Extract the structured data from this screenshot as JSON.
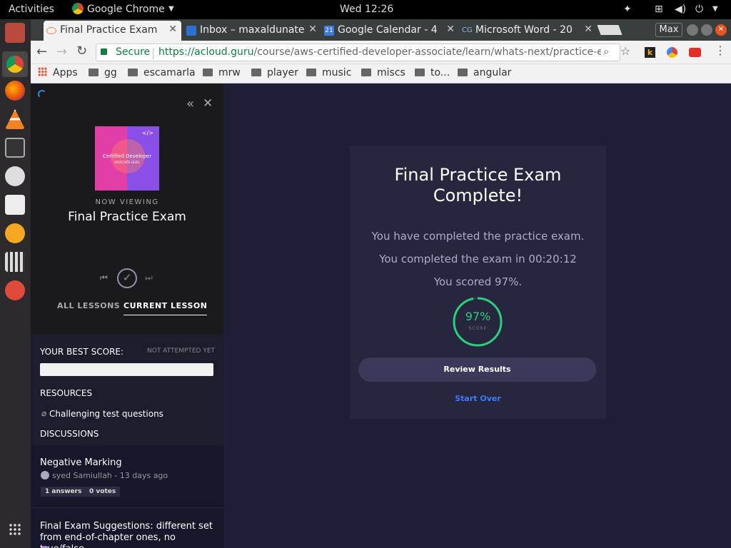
{
  "topbar": {
    "activities": "Activities",
    "app": "Google Chrome",
    "clock": "Wed 12:26"
  },
  "tabs": [
    {
      "label": "Final Practice Exam"
    },
    {
      "label": "Inbox – maxaldunate"
    },
    {
      "label": "Google Calendar - 4"
    },
    {
      "label": "Microsoft Word - 20"
    }
  ],
  "calendar_day": "21",
  "word_favicon": "CG",
  "profile": "Max",
  "address": {
    "secure": "Secure",
    "url_base": "https://acloud.guru",
    "url_path": "/course/aws-certified-developer-associate/learn/whats-next/practice-exam/..."
  },
  "bookmarks": [
    "Apps",
    "gg",
    "escamarla",
    "mrw",
    "player",
    "music",
    "miscs",
    "to...",
    "angular"
  ],
  "ext_k": "k",
  "sidebar": {
    "thumb_title": "Certified Developer",
    "thumb_sub": "ASSOCIATE LEVEL",
    "thumb_code": "</>",
    "now_viewing": "NOW VIEWING",
    "lesson_title": "Final Practice Exam",
    "tab_all": "ALL LESSONS",
    "tab_current": "CURRENT LESSON",
    "best_score_label": "YOUR BEST SCORE:",
    "best_score_status": "NOT ATTEMPTED YET",
    "resources_label": "RESOURCES",
    "resource_item": "Challenging test questions",
    "discussions_label": "DISCUSSIONS",
    "discussions": [
      {
        "title": "Negative Marking",
        "author": "syed Samiullah - 13 days ago",
        "answers": "1 answers",
        "votes": "0 votes"
      },
      {
        "title": "Final Exam Suggestions: different set from end-of-chapter ones, no true/false",
        "author": ""
      }
    ]
  },
  "result": {
    "title_l1": "Final Practice Exam",
    "title_l2": "Complete!",
    "line1": "You have completed the practice exam.",
    "line2": "You completed the exam in 00:20:12",
    "line3": "You scored 97%.",
    "score_text": "97%",
    "score_label": "SCORE",
    "score_fraction": 0.97,
    "review_button": "Review Results",
    "start_over": "Start Over"
  },
  "colors": {
    "accent_green": "#2bd07b",
    "link_blue": "#3b7dfa",
    "url_green": "#0b8043"
  }
}
